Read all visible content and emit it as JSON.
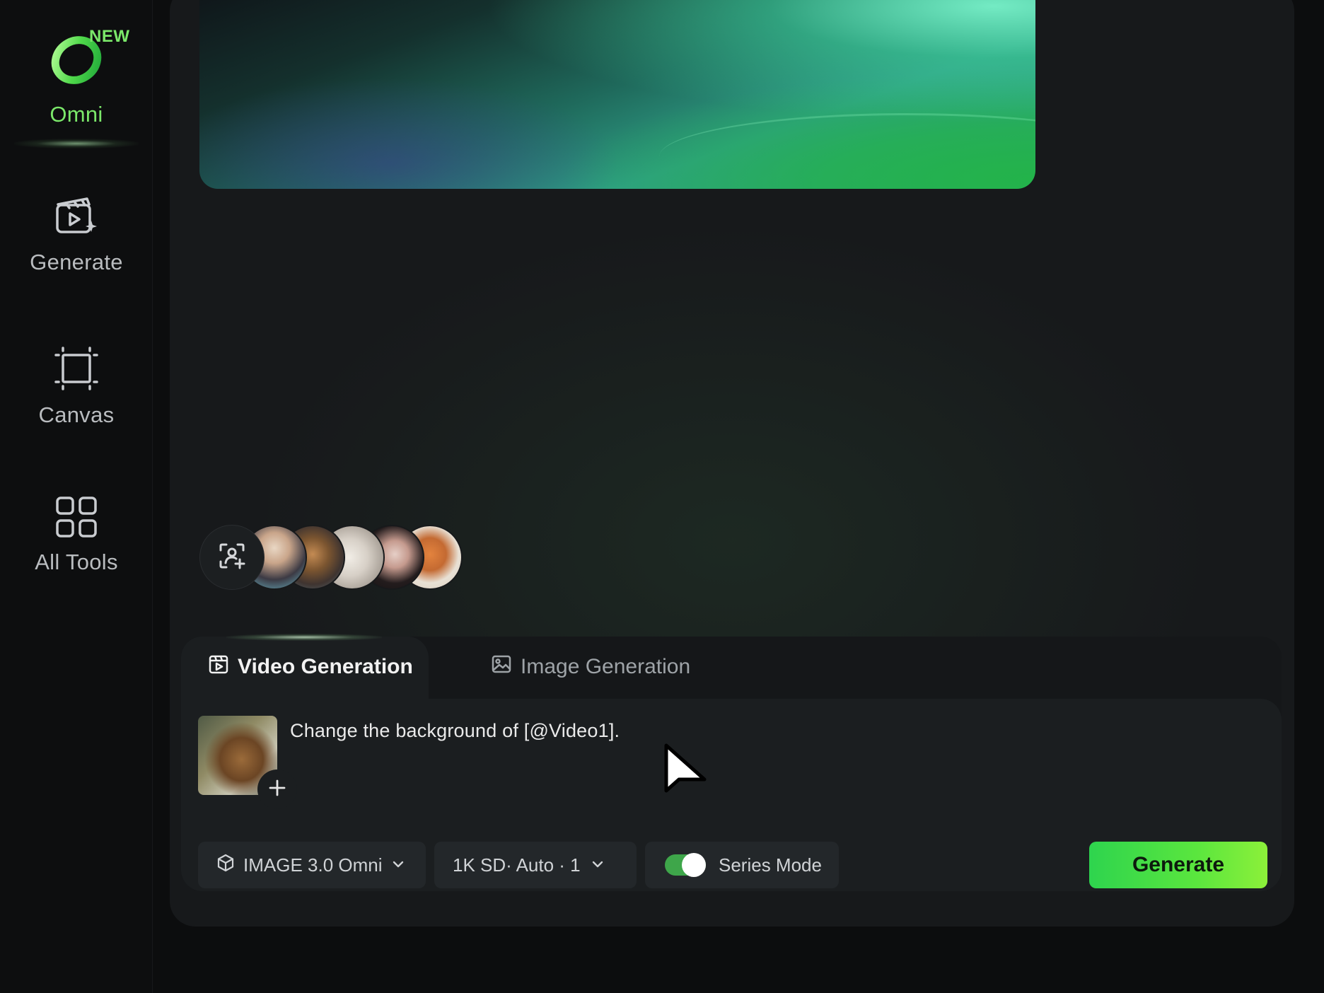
{
  "sidebar": {
    "omni": {
      "badge": "NEW",
      "label": "Omni",
      "icon": "omni-ring-logo"
    },
    "items": [
      {
        "label": "Generate",
        "icon": "clapperboard-sparkle-icon"
      },
      {
        "label": "Canvas",
        "icon": "canvas-frame-icon"
      },
      {
        "label": "All Tools",
        "icon": "grid-icon"
      }
    ]
  },
  "avatars": {
    "add_icon": "add-person-icon",
    "count": 5
  },
  "composer": {
    "tabs": [
      {
        "label": "Video Generation",
        "icon": "video-icon",
        "active": true
      },
      {
        "label": "Image Generation",
        "icon": "image-icon",
        "active": false
      }
    ],
    "prompt": "Change the background of [@Video1].",
    "controls": {
      "model": "IMAGE 3.0 Omni",
      "resolution": "1K SD· Auto · 1",
      "series_mode_label": "Series Mode",
      "series_mode_on": true,
      "generate_label": "Generate"
    }
  },
  "colors": {
    "accent": "#5ae63e",
    "omni_green": "#7be86a",
    "background": "#0c0d0e",
    "panel": "#17191b"
  }
}
